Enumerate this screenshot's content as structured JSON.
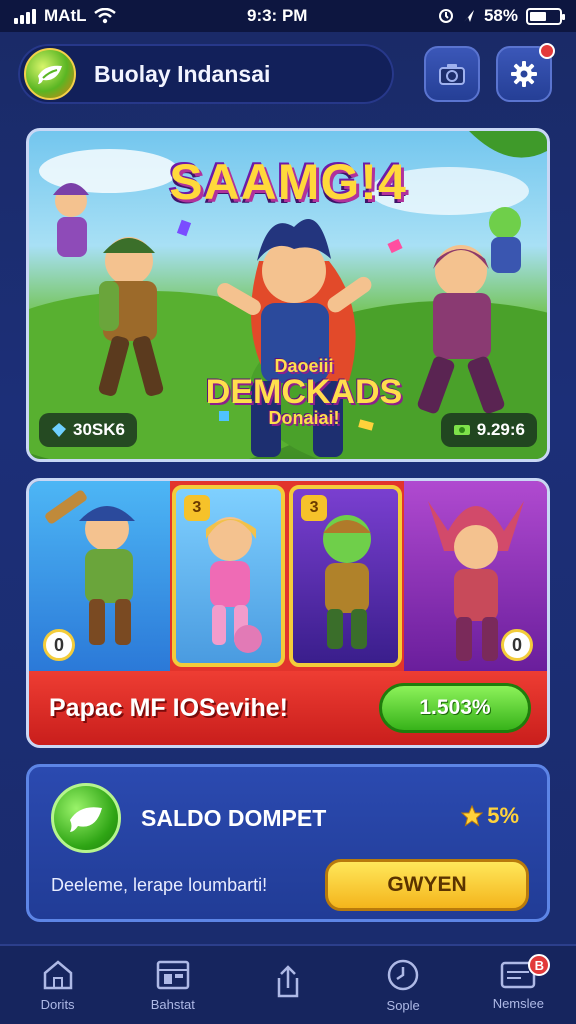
{
  "status_bar": {
    "carrier": "MAtL",
    "time": "9:3: PM",
    "battery": "58%",
    "battery_level": 0.58
  },
  "header": {
    "app_title": "Buolay Indansai",
    "logo_icon": "leaf-logo-icon",
    "camera_icon": "camera-icon",
    "settings_icon": "gear-icon"
  },
  "hero": {
    "title": "SAAMG!4",
    "subtitle_top": "Daoeiii",
    "subtitle_main": "DEMCKADS",
    "subtitle_bottom": "Donaiai!",
    "left_chip": "30SK6",
    "right_chip": "9.29:6"
  },
  "cards": {
    "card2_badge": "3",
    "card3_badge": "3",
    "card1_number": "0",
    "card4_number": "0"
  },
  "promo": {
    "text": "Papac MF IOSevihe!",
    "button_label": "1.503%"
  },
  "wallet": {
    "title": "SALDO DOMPET",
    "bonus": "5%",
    "description": "Deeleme, lerape loumbarti!",
    "button_label": "GWYEN"
  },
  "bottom_nav": {
    "items": [
      {
        "label": "Dorits",
        "icon": "home-icon"
      },
      {
        "label": "Bahstat",
        "icon": "store-icon"
      },
      {
        "label": "",
        "icon": "share-icon"
      },
      {
        "label": "Sople",
        "icon": "clock-icon"
      },
      {
        "label": "Nemslee",
        "icon": "inbox-icon",
        "badge": "B"
      }
    ]
  },
  "colors": {
    "background": "#1c2f78",
    "promo_red": "#e2342c",
    "green_button": "#37b31a",
    "yellow_button": "#f4b51c"
  }
}
